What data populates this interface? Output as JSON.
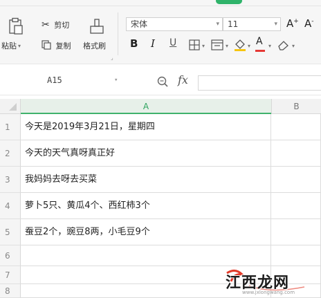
{
  "ribbon": {
    "paste_label": "粘贴",
    "cut_label": "剪切",
    "copy_label": "复制",
    "format_painter_label": "格式刷",
    "font_name": "宋体",
    "font_size": "11",
    "grow_font": "A",
    "grow_sup": "+",
    "shrink_font": "A",
    "shrink_sup": "-",
    "bold": "B",
    "italic": "I",
    "underline": "U",
    "font_color_letter": "A",
    "accent_green": "#2fb36a",
    "font_color_bar": "#e53935",
    "fill_color_bar": "#f6c50f"
  },
  "formula_bar": {
    "cell_ref": "A15",
    "fx_label": "fx",
    "formula_value": ""
  },
  "columns": [
    {
      "label": "A",
      "selected": true
    },
    {
      "label": "B",
      "selected": false
    }
  ],
  "rows": [
    {
      "num": "1",
      "a": "今天是2019年3月21日，星期四",
      "b": ""
    },
    {
      "num": "2",
      "a": "今天的天气真呀真正好",
      "b": ""
    },
    {
      "num": "3",
      "a": "我妈妈去呀去买菜",
      "b": ""
    },
    {
      "num": "4",
      "a": "萝卜5只、黄瓜4个、西红柿3个",
      "b": ""
    },
    {
      "num": "5",
      "a": "蚕豆2个，豌豆8两，小毛豆9个",
      "b": ""
    },
    {
      "num": "6",
      "a": "",
      "b": ""
    },
    {
      "num": "7",
      "a": "",
      "b": ""
    },
    {
      "num": "8",
      "a": "",
      "b": ""
    }
  ],
  "watermark": {
    "text": "江西龙网",
    "sub": "www.jxlongwang.com"
  }
}
